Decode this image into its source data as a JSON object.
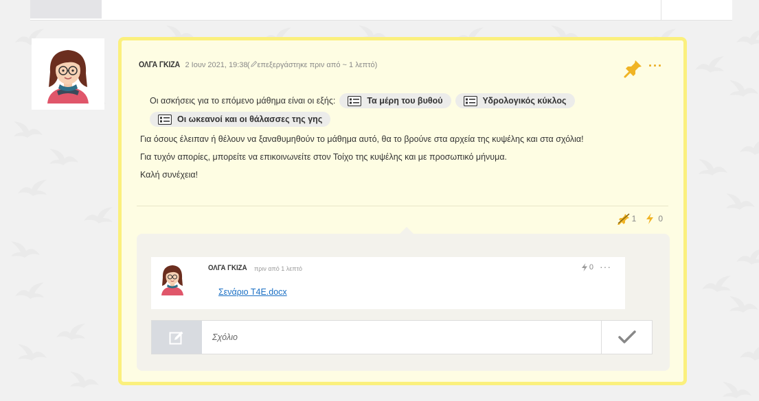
{
  "post": {
    "author": "ΟΛΓΑ ΓΚΙΖΑ",
    "date": "2 Ιουν 2021, 19:38",
    "edited": "επεξεργάστηκε πριν από ~ 1 λεπτό",
    "intro": "Οι ασκήσεις για το επόμενο μάθημα είναι οι εξής:",
    "attachments": [
      {
        "label": "Τα μέρη του βυθού",
        "icon": "list-card-icon"
      },
      {
        "label": "Υδρολογικός κύκλος",
        "icon": "list-card-icon"
      },
      {
        "label": "Οι ωκεανοί και οι θάλασσες της γης",
        "icon": "list-card-icon"
      }
    ],
    "paragraphs": [
      "Για όσους έλειπαν ή θέλουν να ξαναθυμηθούν το μάθημα αυτό, θα το βρούνε στα αρχεία της κυψέλης και στα σχόλια!",
      "Για τυχόν απορίες, μπορείτε να επικοινωνείτε στον Τοίχο της κυψέλης και με προσωπικό μήνυμα.",
      "Καλή συνέχεια!"
    ],
    "pin_count": "1",
    "bolt_count": "0",
    "more": "···"
  },
  "comment": {
    "author": "ΟΛΓΑ ΓΚΙΖΑ",
    "time": "πριν από 1 λεπτό",
    "bolt_count": "0",
    "more": "···",
    "link": "Σενάριο Τ4Ε.docx"
  },
  "comment_input": {
    "placeholder": "Σχόλιο"
  },
  "colors": {
    "card_border": "#fbf07d",
    "card_background": "#fefde3",
    "accent_orange": "#e8a816",
    "link": "#1a6fc4"
  }
}
